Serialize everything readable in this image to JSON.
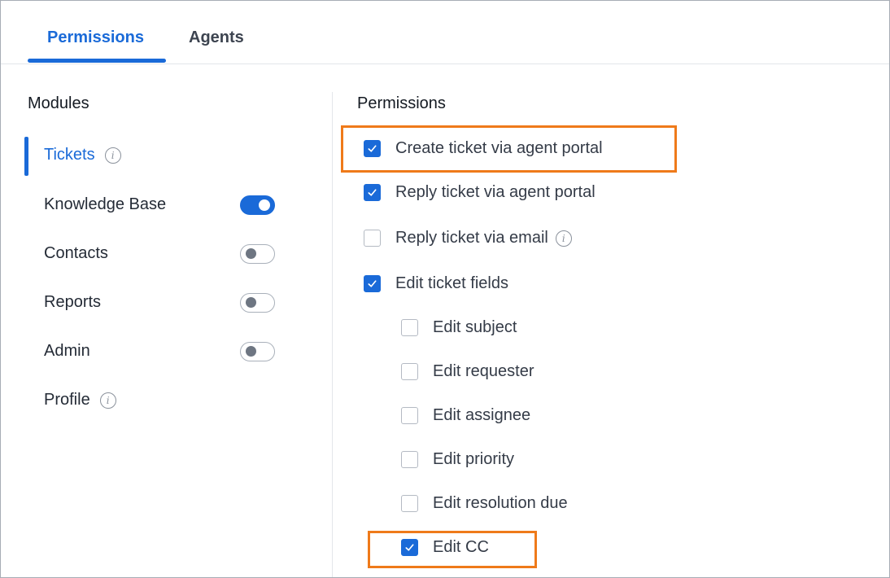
{
  "tabs": [
    {
      "label": "Permissions",
      "active": true
    },
    {
      "label": "Agents",
      "active": false
    }
  ],
  "modules": {
    "title": "Modules",
    "items": [
      {
        "label": "Tickets",
        "active": true,
        "info": true
      },
      {
        "label": "Knowledge Base",
        "toggle": "on"
      },
      {
        "label": "Contacts",
        "toggle": "off"
      },
      {
        "label": "Reports",
        "toggle": "off"
      },
      {
        "label": "Admin",
        "toggle": "off"
      },
      {
        "label": "Profile",
        "info": true
      }
    ]
  },
  "permissions": {
    "title": "Permissions",
    "items": [
      {
        "label": "Create ticket via agent portal",
        "checked": true,
        "highlighted": true
      },
      {
        "label": "Reply ticket via agent portal",
        "checked": true
      },
      {
        "label": "Reply ticket via email",
        "checked": false,
        "info": true
      },
      {
        "label": "Edit ticket fields",
        "checked": true
      },
      {
        "label": "Edit subject",
        "checked": false,
        "indent": true
      },
      {
        "label": "Edit requester",
        "checked": false,
        "indent": true
      },
      {
        "label": "Edit assignee",
        "checked": false,
        "indent": true
      },
      {
        "label": "Edit priority",
        "checked": false,
        "indent": true
      },
      {
        "label": "Edit resolution due",
        "checked": false,
        "indent": true
      },
      {
        "label": "Edit CC",
        "checked": true,
        "indent": true,
        "highlighted": true
      }
    ]
  },
  "colors": {
    "accent": "#1a6ad8",
    "highlight": "#ef7a1a"
  },
  "icons": {
    "info": "info-icon",
    "check": "check-icon"
  }
}
